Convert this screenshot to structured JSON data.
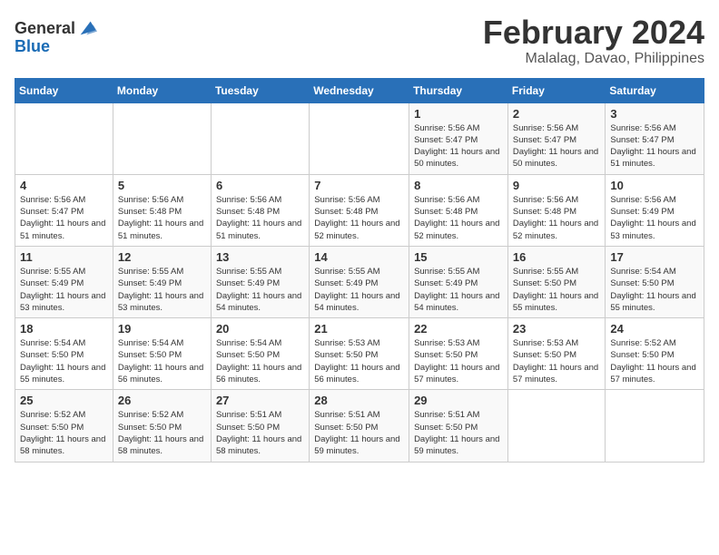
{
  "logo": {
    "general": "General",
    "blue": "Blue"
  },
  "title": {
    "month": "February 2024",
    "location": "Malalag, Davao, Philippines"
  },
  "headers": [
    "Sunday",
    "Monday",
    "Tuesday",
    "Wednesday",
    "Thursday",
    "Friday",
    "Saturday"
  ],
  "weeks": [
    [
      {
        "day": "",
        "sunrise": "",
        "sunset": "",
        "daylight": ""
      },
      {
        "day": "",
        "sunrise": "",
        "sunset": "",
        "daylight": ""
      },
      {
        "day": "",
        "sunrise": "",
        "sunset": "",
        "daylight": ""
      },
      {
        "day": "",
        "sunrise": "",
        "sunset": "",
        "daylight": ""
      },
      {
        "day": "1",
        "sunrise": "Sunrise: 5:56 AM",
        "sunset": "Sunset: 5:47 PM",
        "daylight": "Daylight: 11 hours and 50 minutes."
      },
      {
        "day": "2",
        "sunrise": "Sunrise: 5:56 AM",
        "sunset": "Sunset: 5:47 PM",
        "daylight": "Daylight: 11 hours and 50 minutes."
      },
      {
        "day": "3",
        "sunrise": "Sunrise: 5:56 AM",
        "sunset": "Sunset: 5:47 PM",
        "daylight": "Daylight: 11 hours and 51 minutes."
      }
    ],
    [
      {
        "day": "4",
        "sunrise": "Sunrise: 5:56 AM",
        "sunset": "Sunset: 5:47 PM",
        "daylight": "Daylight: 11 hours and 51 minutes."
      },
      {
        "day": "5",
        "sunrise": "Sunrise: 5:56 AM",
        "sunset": "Sunset: 5:48 PM",
        "daylight": "Daylight: 11 hours and 51 minutes."
      },
      {
        "day": "6",
        "sunrise": "Sunrise: 5:56 AM",
        "sunset": "Sunset: 5:48 PM",
        "daylight": "Daylight: 11 hours and 51 minutes."
      },
      {
        "day": "7",
        "sunrise": "Sunrise: 5:56 AM",
        "sunset": "Sunset: 5:48 PM",
        "daylight": "Daylight: 11 hours and 52 minutes."
      },
      {
        "day": "8",
        "sunrise": "Sunrise: 5:56 AM",
        "sunset": "Sunset: 5:48 PM",
        "daylight": "Daylight: 11 hours and 52 minutes."
      },
      {
        "day": "9",
        "sunrise": "Sunrise: 5:56 AM",
        "sunset": "Sunset: 5:48 PM",
        "daylight": "Daylight: 11 hours and 52 minutes."
      },
      {
        "day": "10",
        "sunrise": "Sunrise: 5:56 AM",
        "sunset": "Sunset: 5:49 PM",
        "daylight": "Daylight: 11 hours and 53 minutes."
      }
    ],
    [
      {
        "day": "11",
        "sunrise": "Sunrise: 5:55 AM",
        "sunset": "Sunset: 5:49 PM",
        "daylight": "Daylight: 11 hours and 53 minutes."
      },
      {
        "day": "12",
        "sunrise": "Sunrise: 5:55 AM",
        "sunset": "Sunset: 5:49 PM",
        "daylight": "Daylight: 11 hours and 53 minutes."
      },
      {
        "day": "13",
        "sunrise": "Sunrise: 5:55 AM",
        "sunset": "Sunset: 5:49 PM",
        "daylight": "Daylight: 11 hours and 54 minutes."
      },
      {
        "day": "14",
        "sunrise": "Sunrise: 5:55 AM",
        "sunset": "Sunset: 5:49 PM",
        "daylight": "Daylight: 11 hours and 54 minutes."
      },
      {
        "day": "15",
        "sunrise": "Sunrise: 5:55 AM",
        "sunset": "Sunset: 5:49 PM",
        "daylight": "Daylight: 11 hours and 54 minutes."
      },
      {
        "day": "16",
        "sunrise": "Sunrise: 5:55 AM",
        "sunset": "Sunset: 5:50 PM",
        "daylight": "Daylight: 11 hours and 55 minutes."
      },
      {
        "day": "17",
        "sunrise": "Sunrise: 5:54 AM",
        "sunset": "Sunset: 5:50 PM",
        "daylight": "Daylight: 11 hours and 55 minutes."
      }
    ],
    [
      {
        "day": "18",
        "sunrise": "Sunrise: 5:54 AM",
        "sunset": "Sunset: 5:50 PM",
        "daylight": "Daylight: 11 hours and 55 minutes."
      },
      {
        "day": "19",
        "sunrise": "Sunrise: 5:54 AM",
        "sunset": "Sunset: 5:50 PM",
        "daylight": "Daylight: 11 hours and 56 minutes."
      },
      {
        "day": "20",
        "sunrise": "Sunrise: 5:54 AM",
        "sunset": "Sunset: 5:50 PM",
        "daylight": "Daylight: 11 hours and 56 minutes."
      },
      {
        "day": "21",
        "sunrise": "Sunrise: 5:53 AM",
        "sunset": "Sunset: 5:50 PM",
        "daylight": "Daylight: 11 hours and 56 minutes."
      },
      {
        "day": "22",
        "sunrise": "Sunrise: 5:53 AM",
        "sunset": "Sunset: 5:50 PM",
        "daylight": "Daylight: 11 hours and 57 minutes."
      },
      {
        "day": "23",
        "sunrise": "Sunrise: 5:53 AM",
        "sunset": "Sunset: 5:50 PM",
        "daylight": "Daylight: 11 hours and 57 minutes."
      },
      {
        "day": "24",
        "sunrise": "Sunrise: 5:52 AM",
        "sunset": "Sunset: 5:50 PM",
        "daylight": "Daylight: 11 hours and 57 minutes."
      }
    ],
    [
      {
        "day": "25",
        "sunrise": "Sunrise: 5:52 AM",
        "sunset": "Sunset: 5:50 PM",
        "daylight": "Daylight: 11 hours and 58 minutes."
      },
      {
        "day": "26",
        "sunrise": "Sunrise: 5:52 AM",
        "sunset": "Sunset: 5:50 PM",
        "daylight": "Daylight: 11 hours and 58 minutes."
      },
      {
        "day": "27",
        "sunrise": "Sunrise: 5:51 AM",
        "sunset": "Sunset: 5:50 PM",
        "daylight": "Daylight: 11 hours and 58 minutes."
      },
      {
        "day": "28",
        "sunrise": "Sunrise: 5:51 AM",
        "sunset": "Sunset: 5:50 PM",
        "daylight": "Daylight: 11 hours and 59 minutes."
      },
      {
        "day": "29",
        "sunrise": "Sunrise: 5:51 AM",
        "sunset": "Sunset: 5:50 PM",
        "daylight": "Daylight: 11 hours and 59 minutes."
      },
      {
        "day": "",
        "sunrise": "",
        "sunset": "",
        "daylight": ""
      },
      {
        "day": "",
        "sunrise": "",
        "sunset": "",
        "daylight": ""
      }
    ]
  ]
}
